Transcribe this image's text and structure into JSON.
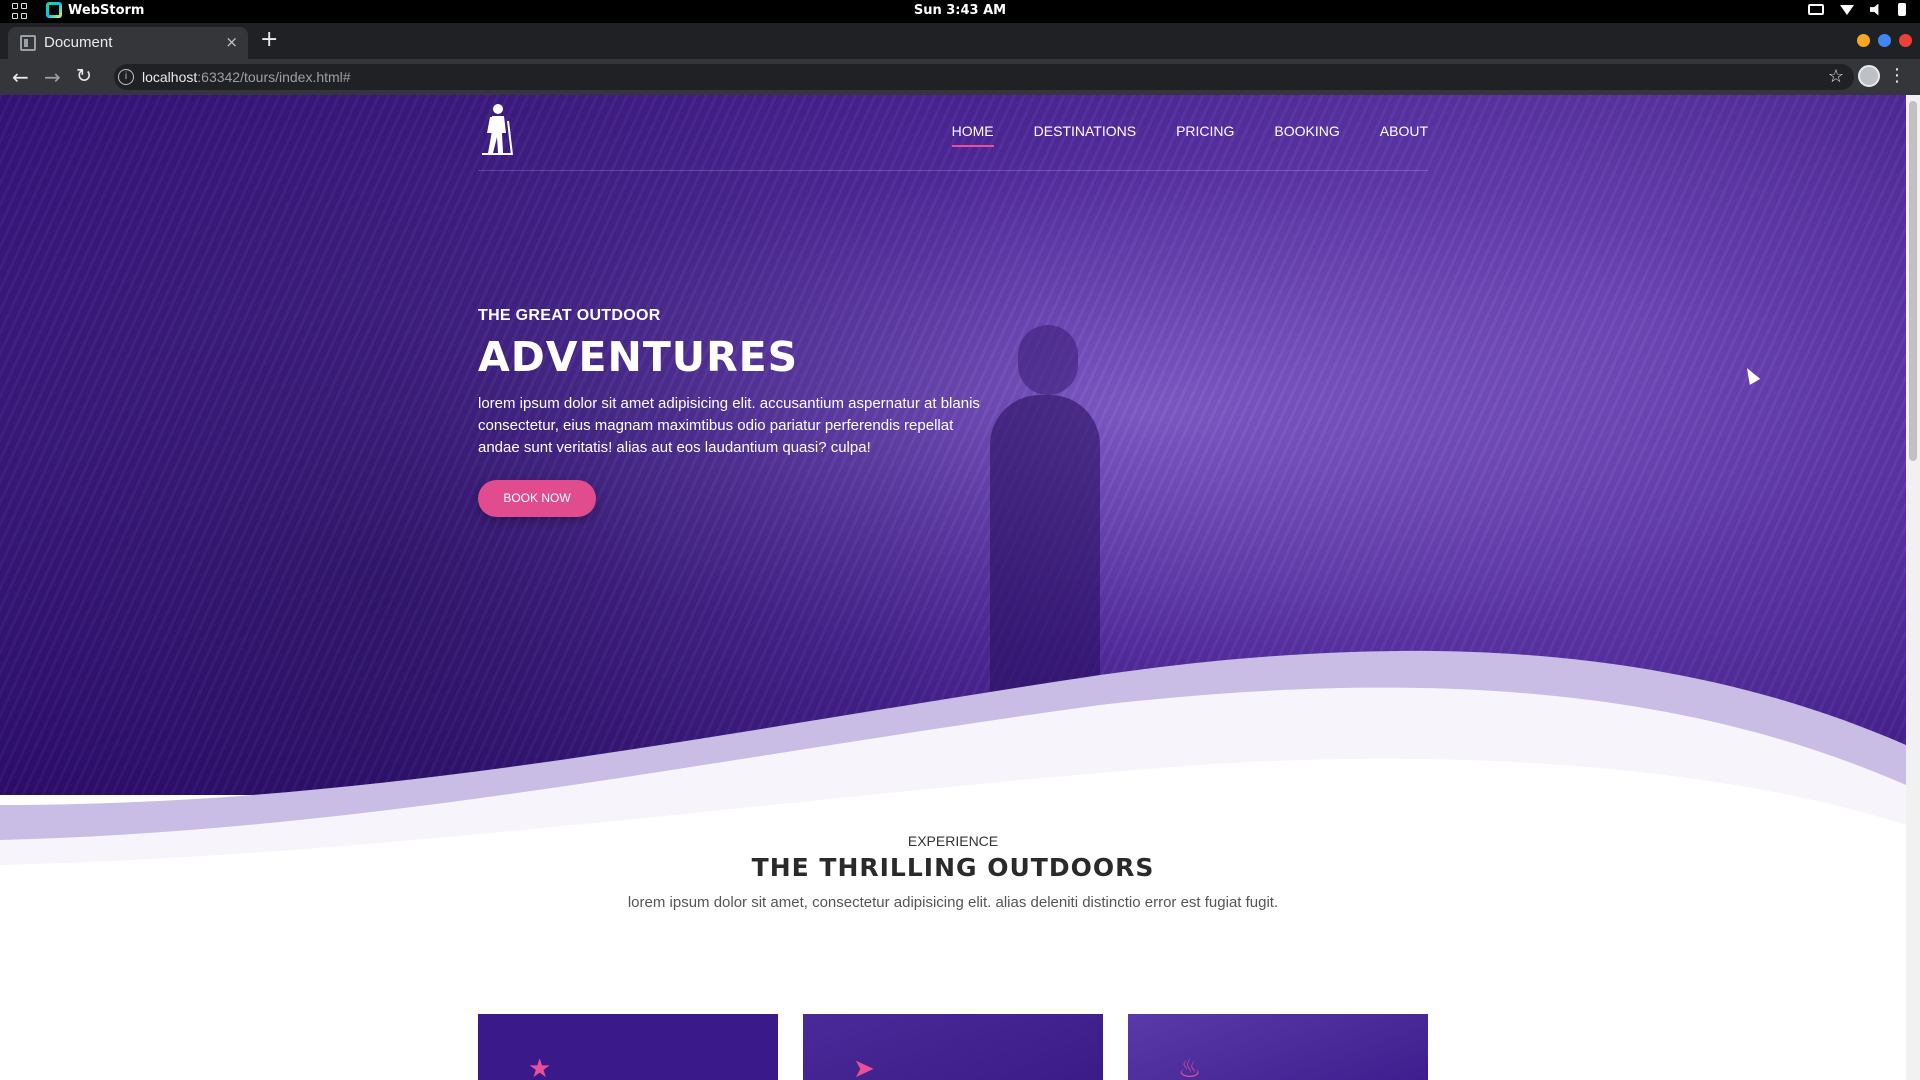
{
  "os_bar": {
    "app_name": "WebStorm",
    "clock": "Sun  3:43 AM"
  },
  "browser": {
    "tab_title": "Document",
    "tab_close": "×",
    "new_tab": "+",
    "url_host": "localhost",
    "url_path": ":63342/tours/index.html#",
    "window_controls_colors": [
      "#f5a623",
      "#4285f4",
      "#ea4335"
    ]
  },
  "site": {
    "nav": [
      {
        "label": "HOME",
        "active": true
      },
      {
        "label": "DESTINATIONS",
        "active": false
      },
      {
        "label": "PRICING",
        "active": false
      },
      {
        "label": "BOOKING",
        "active": false
      },
      {
        "label": "ABOUT",
        "active": false
      }
    ],
    "hero": {
      "kicker": "THE GREAT OUTDOOR",
      "title": "ADVENTURES",
      "body": "lorem ipsum dolor sit amet adipisicing elit. accusantium aspernatur at blanis consectetur, eius magnam maximtibus odio pariatur perferendis repellat andae sunt veritatis! alias aut eos laudantium quasi? culpa!",
      "cta": "BOOK NOW"
    },
    "section": {
      "eyebrow": "EXPERIENCE",
      "title": "THE THRILLING OUTDOORS",
      "text": "lorem ipsum dolor sit amet, consectetur adipisicing elit. alias deleniti distinctio error est fugiat fugit."
    },
    "cards": [
      {
        "icon": "star-icon"
      },
      {
        "icon": "compass-icon"
      },
      {
        "icon": "fire-icon"
      }
    ]
  },
  "colors": {
    "hero_purple": "#3b1a8c",
    "accent_pink": "#e04c8e",
    "wave_lavender": "#c9bde6"
  }
}
